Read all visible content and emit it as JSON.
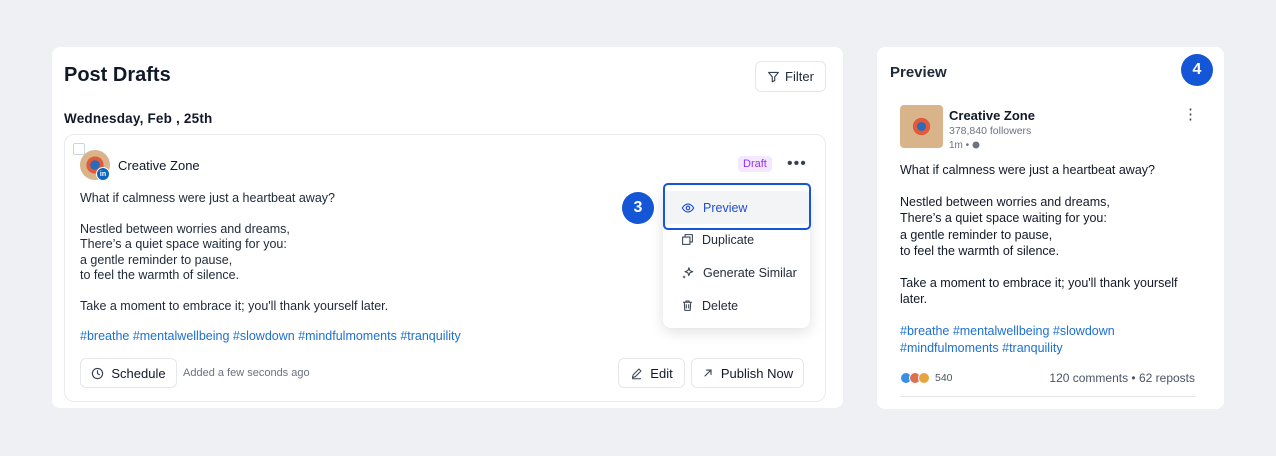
{
  "drafts": {
    "title": "Post Drafts",
    "filter_label": "Filter",
    "date_heading": "Wednesday, Feb , 25th",
    "post": {
      "author": "Creative Zone",
      "network_badge": "in",
      "status": "Draft",
      "lines": [
        "What if calmness were just a heartbeat away?",
        "Nestled between worries and dreams,",
        "There’s a quiet space waiting for you:",
        "a gentle reminder to pause,",
        "to feel the warmth of silence.",
        "Take a moment to embrace it; you'll thank yourself later."
      ],
      "hashtags": "#breathe #mentalwellbeing #slowdown #mindfulmoments #tranquility",
      "schedule_label": "Schedule",
      "added_text": "Added a few seconds ago",
      "edit_label": "Edit",
      "publish_label": "Publish Now"
    },
    "menu": {
      "preview": "Preview",
      "duplicate": "Duplicate",
      "generate_similar": "Generate Similar",
      "delete": "Delete"
    }
  },
  "steps": {
    "step3": "3",
    "step4": "4"
  },
  "preview": {
    "title": "Preview",
    "author": "Creative Zone",
    "followers": "378,840 followers",
    "time": "1m •",
    "lines": [
      "What if calmness were just a heartbeat away?",
      "Nestled between worries and dreams,",
      "There’s a quiet space waiting for you:",
      "a gentle reminder to pause,",
      "to feel the warmth of silence.",
      "Take a moment to embrace it; you'll thank yourself",
      "later."
    ],
    "hashtags_line1": "#breathe #mentalwellbeing #slowdown",
    "hashtags_line2": "#mindfulmoments #tranquility",
    "reaction_count": "540",
    "stats": "120 comments • 62 reposts"
  },
  "colors": {
    "accent": "#1456d6",
    "link": "#1d6fd1",
    "draft_text": "#9333ea",
    "draft_bg": "#f3e8ff"
  },
  "icons": [
    "filter-icon",
    "clock-icon",
    "pencil-icon",
    "arrow-up-right-icon",
    "eye-icon",
    "duplicate-icon",
    "sparkle-icon",
    "trash-icon",
    "more-icon",
    "globe-icon"
  ]
}
